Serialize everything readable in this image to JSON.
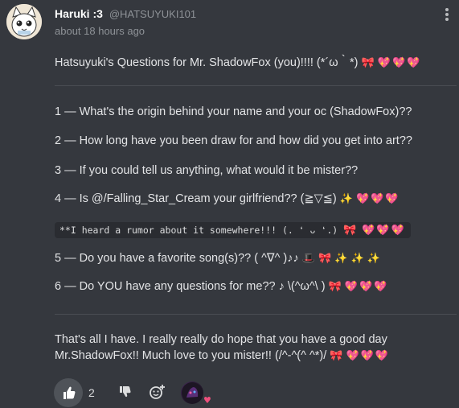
{
  "header": {
    "author_name": "Haruki :3",
    "author_handle": "@HATSUYUKI101",
    "timestamp": "about 18 hours ago"
  },
  "intro": {
    "text": "Hatsuyuki's Questions for Mr. ShadowFox (you)!!!! (*´ω｀*)",
    "decor": "💖💖💖"
  },
  "questions": [
    {
      "text": "1 — What's the origin behind your name and your oc (ShadowFox)??"
    },
    {
      "text": "2 — How long have you been draw for and how did you get into art??"
    },
    {
      "text": "3 — If you could tell us anything, what would it be mister??"
    },
    {
      "text": "4 — Is @/Falling_Star_Cream your girlfriend?? (≧▽≦)",
      "decor": "💖💖💖"
    },
    {
      "text": "5 — Do you have a favorite song(s)?? ( ^∇^ )♪♪"
    },
    {
      "text": "6 — Do YOU have any questions for me?? ♪ \\(^ω^\\ )",
      "decor": "💖💖💖"
    }
  ],
  "rumor": {
    "text": "**I heard a rumor about it somewhere!!! (. ❛ ᴗ ❛.)",
    "decor": "💖💖💖"
  },
  "closing": {
    "line1": "That's all I have. I really really do hope that you have a good day",
    "line2": "Mr.ShadowFox!! Much love to you mister!! (/^-^(^ ^*)/",
    "decor": "💖💖💖"
  },
  "actions": {
    "like_count": "2"
  },
  "colors": {
    "background": "#35383e",
    "divider": "#4a4d53",
    "heart": "#ef4f6f"
  },
  "icons": [
    "avatar-cat",
    "kebab-menu-icon",
    "thumbs-up-icon",
    "thumbs-down-icon",
    "add-reaction-icon",
    "bow-emoji",
    "sparkle-emoji",
    "top-hat-emoji"
  ]
}
